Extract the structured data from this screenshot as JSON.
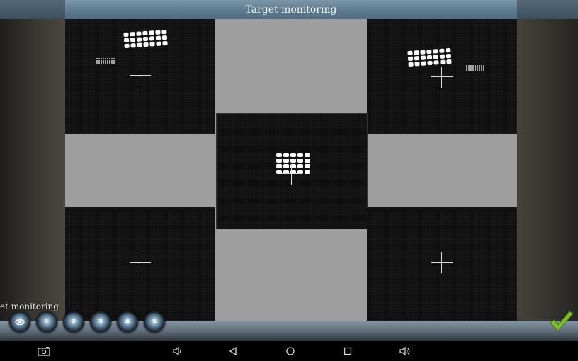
{
  "window": {
    "title": "Target monitoring"
  },
  "monitor": {
    "views": [
      {
        "id": "top-left",
        "dots_main": "3x7",
        "dots_small": "yes"
      },
      {
        "id": "top-right",
        "dots_main": "3x7",
        "dots_small": "yes"
      },
      {
        "id": "center",
        "dots_main": "4x5"
      },
      {
        "id": "bottom-left"
      },
      {
        "id": "bottom-right"
      }
    ]
  },
  "toolbar": {
    "mode_label": "et monitoring",
    "buttons": [
      "",
      "1",
      "2",
      "3",
      "4",
      "5"
    ],
    "confirm_icon": "checkmark-icon"
  },
  "navbar": {
    "icons": [
      "screenshot-icon",
      "volume-down-icon",
      "back-icon",
      "home-icon",
      "recents-icon",
      "volume-up-icon"
    ]
  },
  "colors": {
    "title_bar": "#5e7b90",
    "camera_bg": "#0f0f0f",
    "frame_bg": "#9e9e9e",
    "confirm": "#7fbf2a"
  }
}
